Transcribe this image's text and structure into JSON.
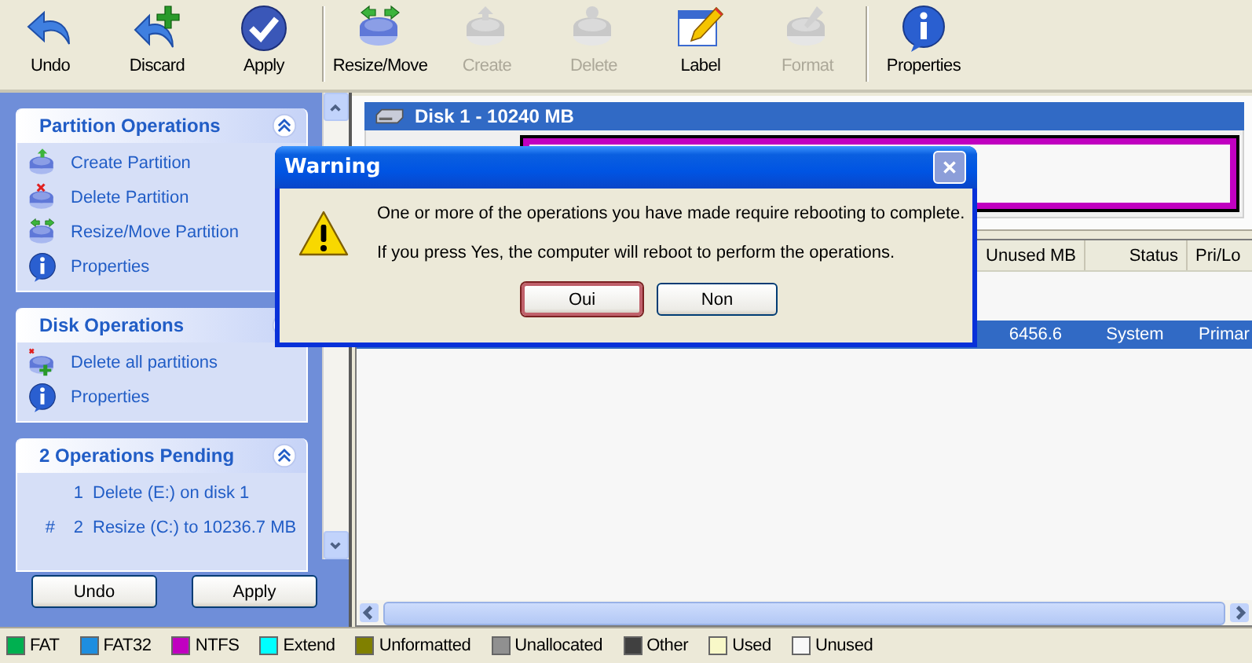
{
  "toolbar": {
    "groups": [
      [
        {
          "label": "Undo",
          "kind": "undo",
          "disabled": false
        },
        {
          "label": "Discard",
          "kind": "discard",
          "disabled": false
        },
        {
          "label": "Apply",
          "kind": "apply",
          "disabled": false
        }
      ],
      [
        {
          "label": "Resize/Move",
          "kind": "resize",
          "disabled": false
        },
        {
          "label": "Create",
          "kind": "create",
          "disabled": true
        },
        {
          "label": "Delete",
          "kind": "delete",
          "disabled": true
        },
        {
          "label": "Label",
          "kind": "label",
          "disabled": false
        },
        {
          "label": "Format",
          "kind": "format",
          "disabled": true
        }
      ],
      [
        {
          "label": "Properties",
          "kind": "properties",
          "disabled": false
        }
      ]
    ]
  },
  "sidebar": {
    "sections": [
      {
        "title": "Partition Operations",
        "kind": "actions",
        "items": [
          {
            "label": "Create Partition",
            "kind": "create"
          },
          {
            "label": "Delete Partition",
            "kind": "delete"
          },
          {
            "label": "Resize/Move Partition",
            "kind": "resize"
          },
          {
            "label": "Properties",
            "kind": "properties"
          }
        ]
      },
      {
        "title": "Disk Operations",
        "kind": "actions",
        "items": [
          {
            "label": "Delete all partitions",
            "kind": "deleteall"
          },
          {
            "label": "Properties",
            "kind": "properties"
          }
        ]
      },
      {
        "title": "2 Operations Pending",
        "kind": "pending",
        "items": [
          {
            "number": "1",
            "text": "Delete (E:) on disk 1"
          },
          {
            "marker": "#",
            "number": "2",
            "text": "Resize (C:) to 10236.7 MB"
          }
        ]
      }
    ],
    "buttons": [
      "Undo",
      "Apply"
    ]
  },
  "disk": {
    "title": "Disk 1 - 10240 MB"
  },
  "table": {
    "columns": [
      "Unused MB",
      "Status",
      "Pri/Lo"
    ],
    "rows": [
      {
        "cells": [
          "6456.6",
          "System",
          "Primar"
        ],
        "selected": true
      }
    ]
  },
  "dialog": {
    "title": "Warning",
    "messages": [
      "One or more of the operations you have made require rebooting to complete.",
      "If you press Yes, the computer will reboot to perform the operations."
    ],
    "buttons": [
      {
        "label": "Oui",
        "focused": true
      },
      {
        "label": "Non",
        "focused": false
      }
    ]
  },
  "legend": [
    {
      "label": "FAT",
      "color": "#00b050"
    },
    {
      "label": "FAT32",
      "color": "#1e8ee0"
    },
    {
      "label": "NTFS",
      "color": "#c000c0"
    },
    {
      "label": "Extend",
      "color": "#00ffff"
    },
    {
      "label": "Unformatted",
      "color": "#808000"
    },
    {
      "label": "Unallocated",
      "color": "#909090"
    },
    {
      "label": "Other",
      "color": "#404040"
    },
    {
      "label": "Used",
      "color": "#f8f8c8"
    },
    {
      "label": "Unused",
      "color": "#f8f8f8"
    }
  ]
}
